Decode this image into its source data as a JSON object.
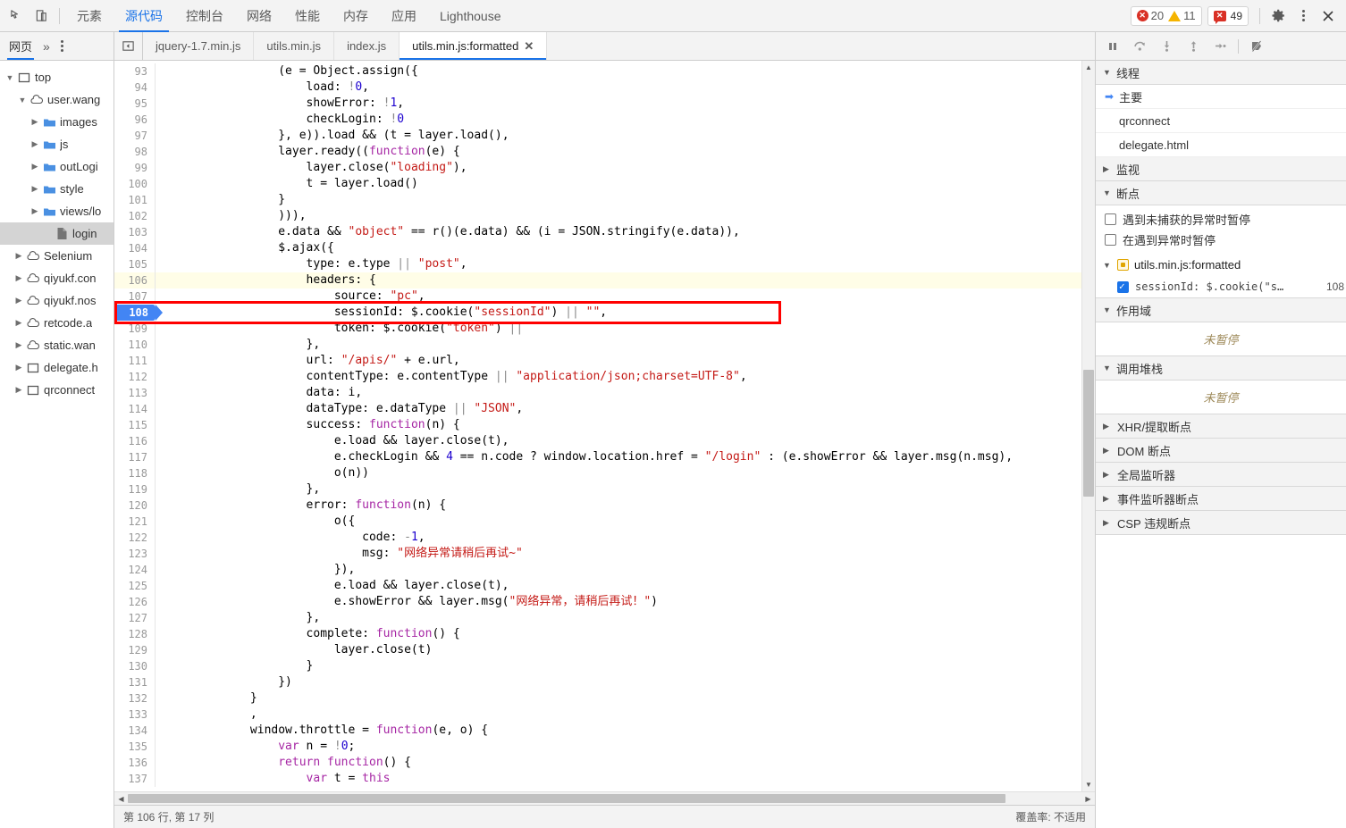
{
  "toolbar": {
    "inspect_icon": "inspect-cursor-icon",
    "device_icon": "device-toolbar-icon",
    "panels": [
      {
        "label": "元素",
        "active": false
      },
      {
        "label": "源代码",
        "active": true
      },
      {
        "label": "控制台",
        "active": false
      },
      {
        "label": "网络",
        "active": false
      },
      {
        "label": "性能",
        "active": false
      },
      {
        "label": "内存",
        "active": false
      },
      {
        "label": "应用",
        "active": false
      },
      {
        "label": "Lighthouse",
        "active": false
      }
    ],
    "badges": {
      "errors": "20",
      "warnings": "11",
      "messages": "49",
      "error_color": "#d93025",
      "warning_color": "#f5b400"
    },
    "settings_icon": "gear-icon",
    "more_icon": "kebab-menu-icon",
    "close_icon": "close-icon"
  },
  "subtoolbar": {
    "nav_label": "网页",
    "more_label": "»",
    "file_tabs": [
      {
        "label": "jquery-1.7.min.js",
        "active": false,
        "closable": false
      },
      {
        "label": "utils.min.js",
        "active": false,
        "closable": false
      },
      {
        "label": "index.js",
        "active": false,
        "closable": false
      },
      {
        "label": "utils.min.js:formatted",
        "active": true,
        "closable": true
      }
    ],
    "close_glyph": "✕",
    "debug_buttons": [
      {
        "name": "pause-resume-button",
        "title": "暂停/继续"
      },
      {
        "name": "step-over-button",
        "title": "跳过下一个函数调用"
      },
      {
        "name": "step-into-button",
        "title": "单步执行"
      },
      {
        "name": "step-out-button",
        "title": "跳出当前函数"
      },
      {
        "name": "step-button",
        "title": "单步"
      },
      {
        "name": "deactivate-breakpoints-button",
        "title": "停用断点"
      }
    ]
  },
  "navigator": {
    "tree": [
      {
        "label": "top",
        "icon": "window-icon",
        "depth": 0,
        "twisty": "▼",
        "selected": false
      },
      {
        "label": "user.wang",
        "icon": "cloud-icon",
        "depth": 1,
        "twisty": "▼",
        "selected": false
      },
      {
        "label": "images",
        "icon": "folder-icon",
        "depth": 2,
        "twisty": "▶",
        "selected": false
      },
      {
        "label": "js",
        "icon": "folder-icon",
        "depth": 2,
        "twisty": "▶",
        "selected": false
      },
      {
        "label": "outLogi",
        "icon": "folder-icon",
        "depth": 2,
        "twisty": "▶",
        "selected": false
      },
      {
        "label": "style",
        "icon": "folder-icon",
        "depth": 2,
        "twisty": "▶",
        "selected": false
      },
      {
        "label": "views/lo",
        "icon": "folder-icon",
        "depth": 2,
        "twisty": "▶",
        "selected": false
      },
      {
        "label": "login",
        "icon": "file-icon",
        "depth": 3,
        "twisty": "",
        "selected": true
      },
      {
        "label": "Selenium",
        "icon": "cloud-icon",
        "depth": 1,
        "twisty": "▶",
        "selected": false
      },
      {
        "label": "qiyukf.con",
        "icon": "cloud-icon",
        "depth": 1,
        "twisty": "▶",
        "selected": false
      },
      {
        "label": "qiyukf.nos",
        "icon": "cloud-icon",
        "depth": 1,
        "twisty": "▶",
        "selected": false
      },
      {
        "label": "retcode.a",
        "icon": "cloud-icon",
        "depth": 1,
        "twisty": "▶",
        "selected": false
      },
      {
        "label": "static.wan",
        "icon": "cloud-icon",
        "depth": 1,
        "twisty": "▶",
        "selected": false
      },
      {
        "label": "delegate.h",
        "icon": "window-icon",
        "depth": 1,
        "twisty": "▶",
        "selected": false
      },
      {
        "label": "qrconnect",
        "icon": "window-icon",
        "depth": 1,
        "twisty": "▶",
        "selected": false
      }
    ]
  },
  "editor": {
    "first_line": 93,
    "current_line": 106,
    "breakpoint_line": 108,
    "annotation_color": "#ff0000",
    "lines": [
      {
        "n": 93,
        "indent": 16,
        "tokens": [
          [
            "plain",
            "(e = Object.assign({"
          ]
        ]
      },
      {
        "n": 94,
        "indent": 20,
        "tokens": [
          [
            "plain",
            "load: "
          ],
          [
            "op",
            "!"
          ],
          [
            "num",
            "0"
          ],
          [
            "plain",
            ","
          ]
        ]
      },
      {
        "n": 95,
        "indent": 20,
        "tokens": [
          [
            "plain",
            "showError: "
          ],
          [
            "op",
            "!"
          ],
          [
            "num",
            "1"
          ],
          [
            "plain",
            ","
          ]
        ]
      },
      {
        "n": 96,
        "indent": 20,
        "tokens": [
          [
            "plain",
            "checkLogin: "
          ],
          [
            "op",
            "!"
          ],
          [
            "num",
            "0"
          ]
        ]
      },
      {
        "n": 97,
        "indent": 16,
        "tokens": [
          [
            "plain",
            "}, e)).load && (t = layer.load(),"
          ]
        ]
      },
      {
        "n": 98,
        "indent": 16,
        "tokens": [
          [
            "plain",
            "layer.ready(("
          ],
          [
            "key",
            "function"
          ],
          [
            "plain",
            "(e) {"
          ]
        ]
      },
      {
        "n": 99,
        "indent": 20,
        "tokens": [
          [
            "plain",
            "layer.close("
          ],
          [
            "str",
            "\"loading\""
          ],
          [
            "plain",
            "),"
          ]
        ]
      },
      {
        "n": 100,
        "indent": 20,
        "tokens": [
          [
            "plain",
            "t = layer.load()"
          ]
        ]
      },
      {
        "n": 101,
        "indent": 16,
        "tokens": [
          [
            "plain",
            "}"
          ]
        ]
      },
      {
        "n": 102,
        "indent": 16,
        "tokens": [
          [
            "plain",
            "))),"
          ]
        ]
      },
      {
        "n": 103,
        "indent": 16,
        "tokens": [
          [
            "plain",
            "e.data && "
          ],
          [
            "str",
            "\"object\""
          ],
          [
            "plain",
            " == r()(e.data) && (i = JSON.stringify(e.data)),"
          ]
        ]
      },
      {
        "n": 104,
        "indent": 16,
        "tokens": [
          [
            "plain",
            "$.ajax({"
          ]
        ]
      },
      {
        "n": 105,
        "indent": 20,
        "tokens": [
          [
            "plain",
            "type: e.type "
          ],
          [
            "op",
            "||"
          ],
          [
            "plain",
            " "
          ],
          [
            "str",
            "\"post\""
          ],
          [
            "plain",
            ","
          ]
        ]
      },
      {
        "n": 106,
        "indent": 20,
        "tokens": [
          [
            "plain",
            "headers: {"
          ]
        ]
      },
      {
        "n": 107,
        "indent": 24,
        "tokens": [
          [
            "plain",
            "source: "
          ],
          [
            "str",
            "\"pc\""
          ],
          [
            "plain",
            ","
          ]
        ]
      },
      {
        "n": 108,
        "indent": 24,
        "tokens": [
          [
            "plain",
            "sessionId: $.cookie("
          ],
          [
            "str",
            "\"sessionId\""
          ],
          [
            "plain",
            ") "
          ],
          [
            "op",
            "||"
          ],
          [
            "plain",
            " "
          ],
          [
            "str",
            "\"\""
          ],
          [
            "plain",
            ","
          ]
        ]
      },
      {
        "n": 109,
        "indent": 24,
        "tokens": [
          [
            "plain",
            "token: $.cookie("
          ],
          [
            "str",
            "\"token\""
          ],
          [
            "plain",
            ") "
          ],
          [
            "op",
            "||"
          ]
        ]
      },
      {
        "n": 110,
        "indent": 20,
        "tokens": [
          [
            "plain",
            "},"
          ]
        ]
      },
      {
        "n": 111,
        "indent": 20,
        "tokens": [
          [
            "plain",
            "url: "
          ],
          [
            "str",
            "\"/apis/\""
          ],
          [
            "plain",
            " + e.url,"
          ]
        ]
      },
      {
        "n": 112,
        "indent": 20,
        "tokens": [
          [
            "plain",
            "contentType: e.contentType "
          ],
          [
            "op",
            "||"
          ],
          [
            "plain",
            " "
          ],
          [
            "str",
            "\"application/json;charset=UTF-8\""
          ],
          [
            "plain",
            ","
          ]
        ]
      },
      {
        "n": 113,
        "indent": 20,
        "tokens": [
          [
            "plain",
            "data: i,"
          ]
        ]
      },
      {
        "n": 114,
        "indent": 20,
        "tokens": [
          [
            "plain",
            "dataType: e.dataType "
          ],
          [
            "op",
            "||"
          ],
          [
            "plain",
            " "
          ],
          [
            "str",
            "\"JSON\""
          ],
          [
            "plain",
            ","
          ]
        ]
      },
      {
        "n": 115,
        "indent": 20,
        "tokens": [
          [
            "plain",
            "success: "
          ],
          [
            "key",
            "function"
          ],
          [
            "plain",
            "(n) {"
          ]
        ]
      },
      {
        "n": 116,
        "indent": 24,
        "tokens": [
          [
            "plain",
            "e.load && layer.close(t),"
          ]
        ]
      },
      {
        "n": 117,
        "indent": 24,
        "tokens": [
          [
            "plain",
            "e.checkLogin && "
          ],
          [
            "num",
            "4"
          ],
          [
            "plain",
            " == n.code ? window.location.href = "
          ],
          [
            "str",
            "\"/login\""
          ],
          [
            "plain",
            " : (e.showError && layer.msg(n.msg),"
          ]
        ]
      },
      {
        "n": 118,
        "indent": 24,
        "tokens": [
          [
            "plain",
            "o(n))"
          ]
        ]
      },
      {
        "n": 119,
        "indent": 20,
        "tokens": [
          [
            "plain",
            "},"
          ]
        ]
      },
      {
        "n": 120,
        "indent": 20,
        "tokens": [
          [
            "plain",
            "error: "
          ],
          [
            "key",
            "function"
          ],
          [
            "plain",
            "(n) {"
          ]
        ]
      },
      {
        "n": 121,
        "indent": 24,
        "tokens": [
          [
            "plain",
            "o({"
          ]
        ]
      },
      {
        "n": 122,
        "indent": 28,
        "tokens": [
          [
            "plain",
            "code: "
          ],
          [
            "op",
            "-"
          ],
          [
            "num",
            "1"
          ],
          [
            "plain",
            ","
          ]
        ]
      },
      {
        "n": 123,
        "indent": 28,
        "tokens": [
          [
            "plain",
            "msg: "
          ],
          [
            "str",
            "\"网络异常请稍后再试~\""
          ]
        ]
      },
      {
        "n": 124,
        "indent": 24,
        "tokens": [
          [
            "plain",
            "}),"
          ]
        ]
      },
      {
        "n": 125,
        "indent": 24,
        "tokens": [
          [
            "plain",
            "e.load && layer.close(t),"
          ]
        ]
      },
      {
        "n": 126,
        "indent": 24,
        "tokens": [
          [
            "plain",
            "e.showError && layer.msg("
          ],
          [
            "str",
            "\"网络异常，请稍后再试！\""
          ],
          [
            "plain",
            ")"
          ]
        ]
      },
      {
        "n": 127,
        "indent": 20,
        "tokens": [
          [
            "plain",
            "},"
          ]
        ]
      },
      {
        "n": 128,
        "indent": 20,
        "tokens": [
          [
            "plain",
            "complete: "
          ],
          [
            "key",
            "function"
          ],
          [
            "plain",
            "() {"
          ]
        ]
      },
      {
        "n": 129,
        "indent": 24,
        "tokens": [
          [
            "plain",
            "layer.close(t)"
          ]
        ]
      },
      {
        "n": 130,
        "indent": 20,
        "tokens": [
          [
            "plain",
            "}"
          ]
        ]
      },
      {
        "n": 131,
        "indent": 16,
        "tokens": [
          [
            "plain",
            "})"
          ]
        ]
      },
      {
        "n": 132,
        "indent": 12,
        "tokens": [
          [
            "plain",
            "}"
          ]
        ]
      },
      {
        "n": 133,
        "indent": 12,
        "tokens": [
          [
            "plain",
            ","
          ]
        ]
      },
      {
        "n": 134,
        "indent": 12,
        "tokens": [
          [
            "plain",
            "window.throttle = "
          ],
          [
            "key",
            "function"
          ],
          [
            "plain",
            "(e, o) {"
          ]
        ]
      },
      {
        "n": 135,
        "indent": 16,
        "tokens": [
          [
            "key",
            "var"
          ],
          [
            "plain",
            " n = "
          ],
          [
            "op",
            "!"
          ],
          [
            "num",
            "0"
          ],
          [
            "plain",
            ";"
          ]
        ]
      },
      {
        "n": 136,
        "indent": 16,
        "tokens": [
          [
            "key",
            "return"
          ],
          [
            "plain",
            " "
          ],
          [
            "key",
            "function"
          ],
          [
            "plain",
            "() {"
          ]
        ]
      },
      {
        "n": 137,
        "indent": 20,
        "tokens": [
          [
            "key",
            "var"
          ],
          [
            "plain",
            " t = "
          ],
          [
            "key",
            "this"
          ]
        ]
      }
    ]
  },
  "statusbar": {
    "position": "第 106 行, 第 17 列",
    "coverage": "覆盖率: 不适用"
  },
  "sidebar": {
    "threads": {
      "header": "线程",
      "twisty": "▼",
      "items": [
        {
          "label": "主要",
          "active": true
        },
        {
          "label": "qrconnect",
          "active": false
        },
        {
          "label": "delegate.html",
          "active": false
        }
      ]
    },
    "watch": {
      "header": "监视",
      "twisty": "▶"
    },
    "breakpoints": {
      "header": "断点",
      "twisty": "▼",
      "options": [
        {
          "label": "遇到未捕获的异常时暂停",
          "checked": false
        },
        {
          "label": "在遇到异常时暂停",
          "checked": false
        }
      ],
      "file": {
        "label": "utils.min.js:formatted",
        "twisty": "▼"
      },
      "entries": [
        {
          "label": "sessionId: $.cookie(\"s…",
          "line": "108",
          "checked": true
        }
      ]
    },
    "scope": {
      "header": "作用域",
      "twisty": "▼",
      "empty": "未暂停"
    },
    "callstack": {
      "header": "调用堆栈",
      "twisty": "▼",
      "empty": "未暂停"
    },
    "collapsed": [
      {
        "label": "XHR/提取断点",
        "twisty": "▶"
      },
      {
        "label": "DOM 断点",
        "twisty": "▶"
      },
      {
        "label": "全局监听器",
        "twisty": "▶"
      },
      {
        "label": "事件监听器断点",
        "twisty": "▶"
      },
      {
        "label": "CSP 违规断点",
        "twisty": "▶"
      }
    ]
  }
}
